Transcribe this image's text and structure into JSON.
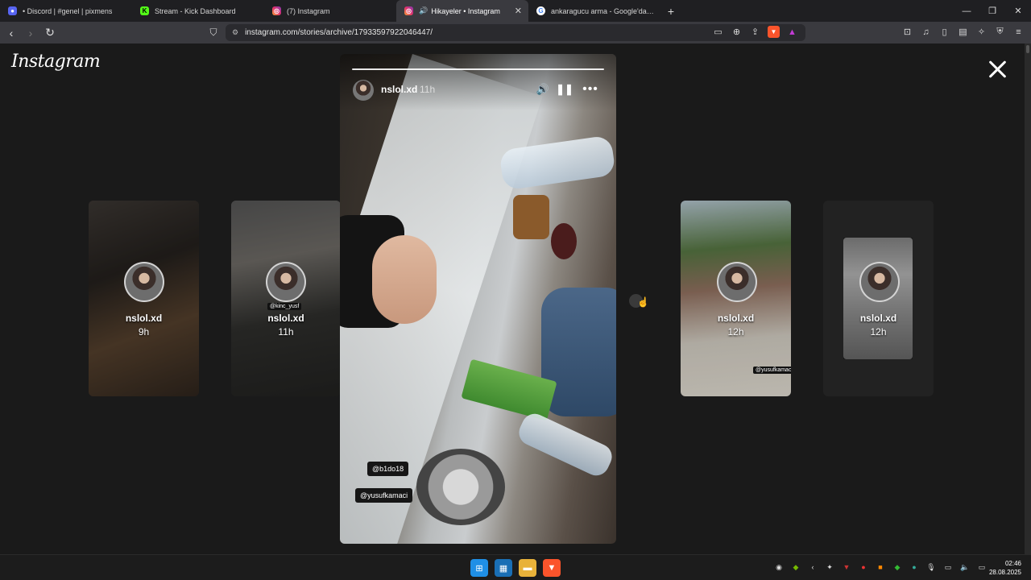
{
  "browser": {
    "tabs": [
      {
        "title": "• Discord | #genel | pixmens",
        "icon": "discord-icon",
        "active": false
      },
      {
        "title": "Stream - Kick Dashboard",
        "icon": "kick-icon",
        "active": false
      },
      {
        "title": "(7) Instagram",
        "icon": "instagram-icon",
        "active": false
      },
      {
        "title": "Hikayeler • Instagram",
        "icon": "instagram-icon",
        "active": true
      },
      {
        "title": "ankaragucu arma - Google'da Ara",
        "icon": "google-icon",
        "active": false
      }
    ],
    "new_tab": "+",
    "url": "instagram.com/stories/archive/17933597922046447/"
  },
  "page": {
    "logo": "Instagram",
    "stories": [
      {
        "username": "nslol.xd",
        "time": "9h"
      },
      {
        "username": "nslol.xd",
        "time": "11h"
      },
      {
        "username": "nslol.xd",
        "time": "12h"
      },
      {
        "username": "nslol.xd",
        "time": "12h"
      }
    ],
    "card_tags": {
      "c2_tag": "@kinc_yusf",
      "c4_tag": "@yusufkamaci"
    },
    "current_story": {
      "username": "nslol.xd",
      "time": "11h",
      "mentions": [
        "@b1do18",
        "@yusufkamaci"
      ],
      "progress": 1.0
    }
  },
  "taskbar": {
    "time": "02:46",
    "date": "28.08.2025"
  },
  "colors": {
    "background": "#1a1a1a",
    "active_tab": "#3a3a3f",
    "brave": "#fb542b"
  }
}
